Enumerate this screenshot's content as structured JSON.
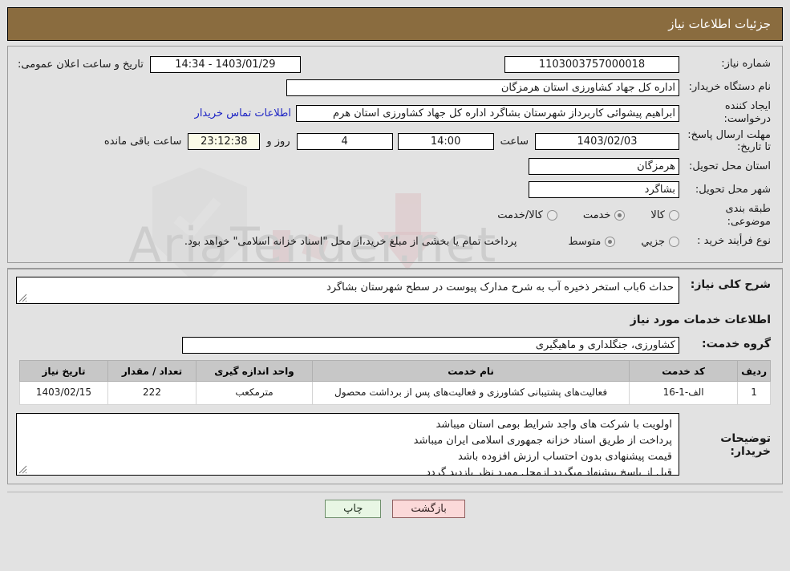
{
  "header": {
    "title": "جزئیات اطلاعات نیاز",
    "bar_color": "#8a6c3f"
  },
  "watermark": {
    "text": "AriaTender.net"
  },
  "form": {
    "need_number_label": "شماره نیاز:",
    "need_number_value": "1103003757000018",
    "public_announce_label": "تاریخ و ساعت اعلان عمومی:",
    "public_announce_value": "14:34 - 1403/01/29",
    "buyer_org_label": "نام دستگاه خریدار:",
    "buyer_org_value": "اداره کل جهاد کشاورزی استان هرمزگان",
    "creator_label": "ایجاد کننده درخواست:",
    "creator_value": "ابراهیم پیشوائی کاربرداز شهرستان بشاگرد اداره کل جهاد کشاورزی استان هرم",
    "contact_link": "اطلاعات تماس خریدار",
    "deadline_label": "مهلت ارسال پاسخ: تا تاریخ:",
    "deadline_date": "1403/02/03",
    "hour_label": "ساعت",
    "deadline_time": "14:00",
    "days_value": "4",
    "days_label": "روز و",
    "countdown_value": "23:12:38",
    "countdown_label": "ساعت باقی مانده",
    "province_label": "استان محل تحویل:",
    "province_value": "هرمزگان",
    "city_label": "شهر محل تحویل:",
    "city_value": "بشاگرد",
    "category_label": "طبقه بندی موضوعی:",
    "category_options": [
      {
        "label": "کالا",
        "checked": false
      },
      {
        "label": "خدمت",
        "checked": true
      },
      {
        "label": "کالا/خدمت",
        "checked": false
      }
    ],
    "process_label": "نوع فرأیند خرید :",
    "process_options": [
      {
        "label": "جزیي",
        "checked": false
      },
      {
        "label": "متوسط",
        "checked": true
      }
    ],
    "payment_note": "پرداخت تمام یا بخشی از مبلغ خرید،از محل \"اسناد خزانه اسلامی\" خواهد بود."
  },
  "need": {
    "summary_label": "شرح کلی نیاز:",
    "summary_value": "حداث 6باب استخر ذخیره آب به شرح مدارک پیوست در سطح شهرستان بشاگرد",
    "services_section_title": "اطلاعات خدمات مورد نیاز",
    "service_group_label": "گروه خدمت:",
    "service_group_value": "کشاورزی، جنگلداری و ماهیگیری"
  },
  "table": {
    "columns": [
      "ردیف",
      "کد خدمت",
      "نام خدمت",
      "واحد اندازه گیری",
      "تعداد / مقدار",
      "تاریخ نیاز"
    ],
    "rows": [
      {
        "index": "1",
        "code": "الف-1-16",
        "name": "فعالیت‌های پشتیبانی کشاورزی و فعالیت‌های پس از برداشت محصول",
        "unit": "مترمکعب",
        "quantity": "222",
        "need_date": "1403/02/15"
      }
    ]
  },
  "buyer_notes": {
    "label": "توضیحات خریدار:",
    "lines": [
      "اولویت با شرکت های واجد شرایط بومی استان میباشد",
      "پرداخت از طریق اسناد خزانه جمهوری اسلامی ایران میباشد",
      "قیمت پیشنهادی بدون احتساب ارزش افزوده باشد",
      "قبل از پاسخ پیشنهاد میگردد ازمحل مورد نظر بازدید گردد"
    ]
  },
  "footer": {
    "print_label": "چاپ",
    "back_label": "بازگشت",
    "print_color": "#e8f6e4",
    "back_color": "#fbd9d9"
  }
}
